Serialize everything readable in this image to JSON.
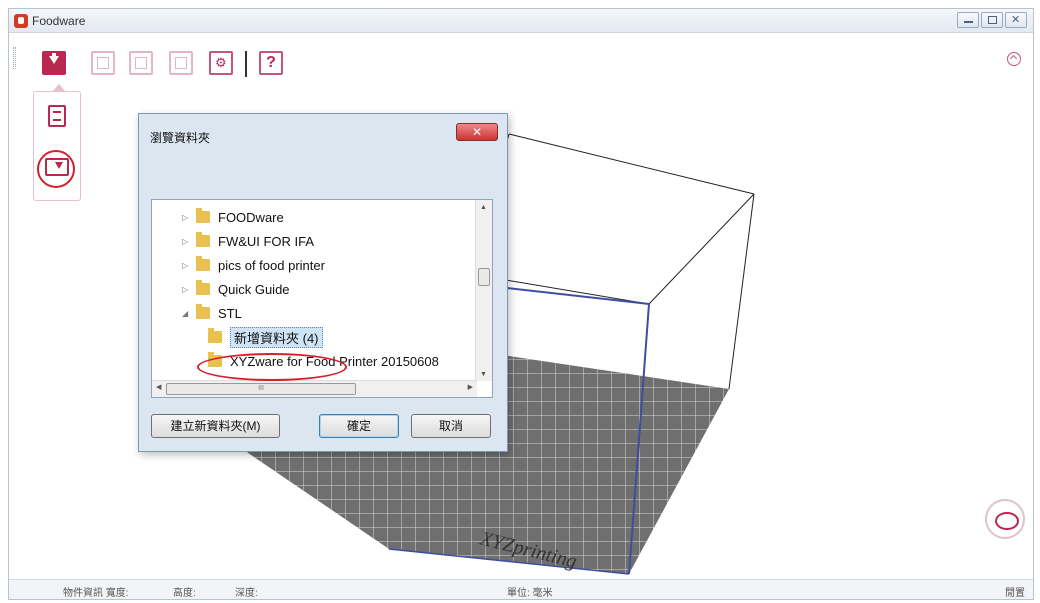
{
  "window": {
    "title": "Foodware"
  },
  "toolbar": {
    "help_label": "?",
    "settings_glyph": "⚙"
  },
  "scene": {
    "bed_watermark": "XYZprinting"
  },
  "dialog": {
    "title": "瀏覽資料夾",
    "close_label": "✕",
    "tree": [
      {
        "label": "FOODware",
        "expander": "▷",
        "indent": 1
      },
      {
        "label": "FW&UI FOR IFA",
        "expander": "▷",
        "indent": 1
      },
      {
        "label": "pics of food printer",
        "expander": "▷",
        "indent": 1
      },
      {
        "label": "Quick Guide",
        "expander": "▷",
        "indent": 1
      },
      {
        "label": "STL",
        "expander": "◢",
        "indent": 1
      },
      {
        "label": "新增資料夾 (4)",
        "expander": "",
        "indent": 2,
        "selected": true
      },
      {
        "label": "XYZware for Food Printer 20150608",
        "expander": "",
        "indent": 2
      }
    ],
    "hscroll_thumb": "III",
    "new_folder_label": "建立新資料夾(M)",
    "ok_label": "確定",
    "cancel_label": "取消"
  },
  "statusbar": {
    "object_info": "物件資訊 寬度:",
    "height": "高度:",
    "depth": "深度:",
    "unit": "單位: 毫米",
    "right": "閒置"
  },
  "icons": [
    "import-icon",
    "export-icon",
    "save-icon",
    "print-icon",
    "settings-icon",
    "help-icon",
    "collapse-icon",
    "file-import-icon",
    "folder-import-icon",
    "eye-view-icon"
  ],
  "colors": {
    "accent": "#b8284f",
    "highlight_circle": "#d6202b",
    "dialog_bg": "#dbe6f1"
  }
}
